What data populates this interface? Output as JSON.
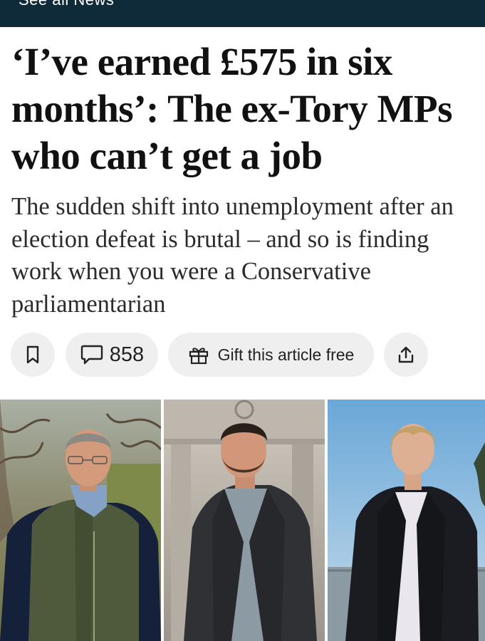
{
  "nav": {
    "see_all_label": "See all News"
  },
  "article": {
    "headline": "‘I’ve earned £575 in six months’: The ex-Tory MPs who can’t get a job",
    "standfirst": "The sudden shift into unemployment after an election defeat is brutal – and so is finding work when you were a Conservative parliamentarian"
  },
  "actions": {
    "bookmark_icon": "bookmark-icon",
    "comments_icon": "comment-bubble-icon",
    "comment_count": "858",
    "gift_icon": "gift-icon",
    "gift_label": "Gift this article free",
    "share_icon": "share-icon"
  },
  "colors": {
    "nav_bg": "#0f2a38",
    "pill_bg": "#efefef",
    "text": "#111111"
  }
}
